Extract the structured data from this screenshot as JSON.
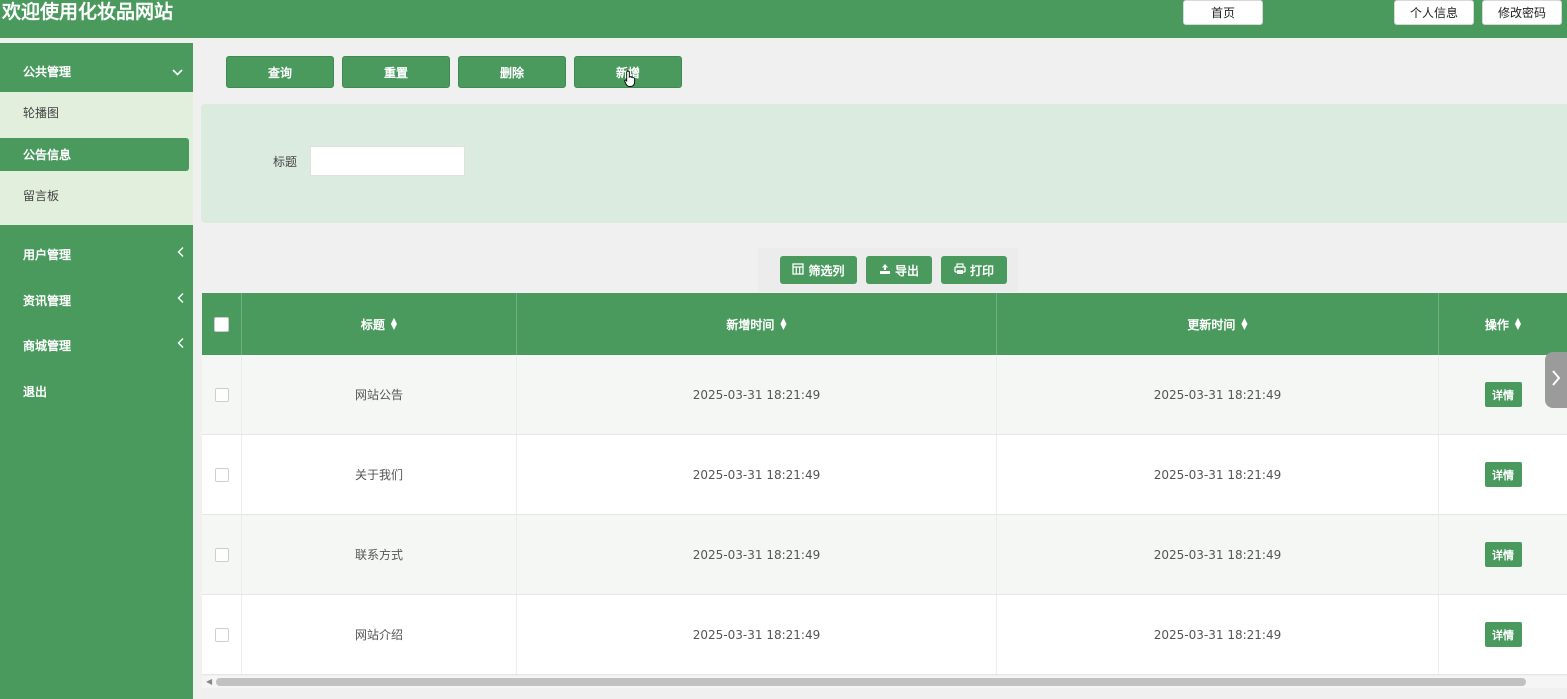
{
  "header": {
    "title": "欢迎使用化妆品网站",
    "home": "首页",
    "profile": "个人信息",
    "change_password": "修改密码"
  },
  "sidebar": {
    "group": {
      "label": "公共管理",
      "expanded": true
    },
    "sub_items": [
      {
        "label": "轮播图",
        "active": false
      },
      {
        "label": "公告信息",
        "active": true
      },
      {
        "label": "留言板",
        "active": false
      }
    ],
    "items": [
      {
        "label": "用户管理"
      },
      {
        "label": "资讯管理"
      },
      {
        "label": "商城管理"
      },
      {
        "label": "退出"
      }
    ]
  },
  "actions": {
    "query": "查询",
    "reset": "重置",
    "delete": "删除",
    "add": "新增"
  },
  "search": {
    "title_label": "标题",
    "title_value": ""
  },
  "toolbar": {
    "filter_columns": "筛选列",
    "export": "导出",
    "print": "打印"
  },
  "table": {
    "columns": [
      "标题",
      "新增时间",
      "更新时间",
      "操作"
    ],
    "rows": [
      {
        "title": "网站公告",
        "created": "2025-03-31 18:21:49",
        "updated": "2025-03-31 18:21:49",
        "action": "详情"
      },
      {
        "title": "关于我们",
        "created": "2025-03-31 18:21:49",
        "updated": "2025-03-31 18:21:49",
        "action": "详情"
      },
      {
        "title": "联系方式",
        "created": "2025-03-31 18:21:49",
        "updated": "2025-03-31 18:21:49",
        "action": "详情"
      },
      {
        "title": "网站介绍",
        "created": "2025-03-31 18:21:49",
        "updated": "2025-03-31 18:21:49",
        "action": "详情"
      }
    ]
  },
  "colors": {
    "primary": "#4a9a5e",
    "panel": "#dcebe0",
    "submenu": "#e2efdd"
  }
}
